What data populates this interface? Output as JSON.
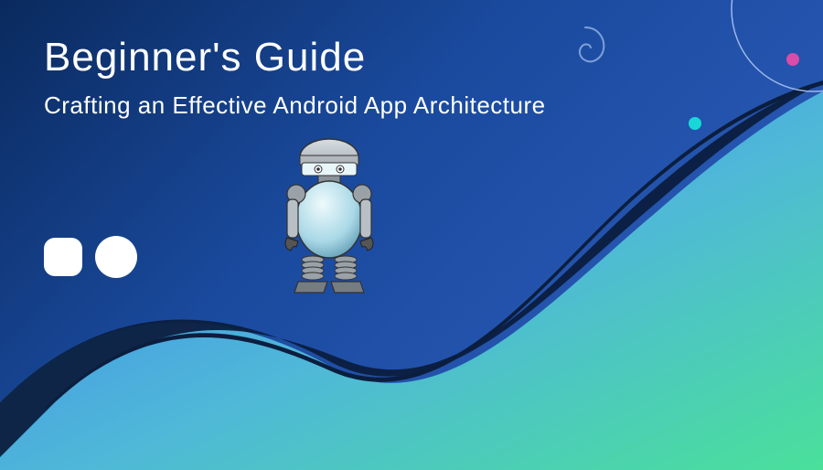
{
  "title": "Beginner's Guide",
  "subtitle": "Crafting an Effective Android App Architecture",
  "colors": {
    "bg_start": "#0a2a5e",
    "bg_end": "#3060c0",
    "wave_green": "#4ae09a",
    "wave_blue": "#3a7cf0",
    "dark_swoosh": "#0b1e3e",
    "dot_cyan": "#19d7d7",
    "dot_magenta": "#d94ca8",
    "white": "#ffffff"
  },
  "icons": {
    "robot": "robot-character",
    "spiral": "spiral-decoration",
    "arc": "arc-decoration"
  }
}
